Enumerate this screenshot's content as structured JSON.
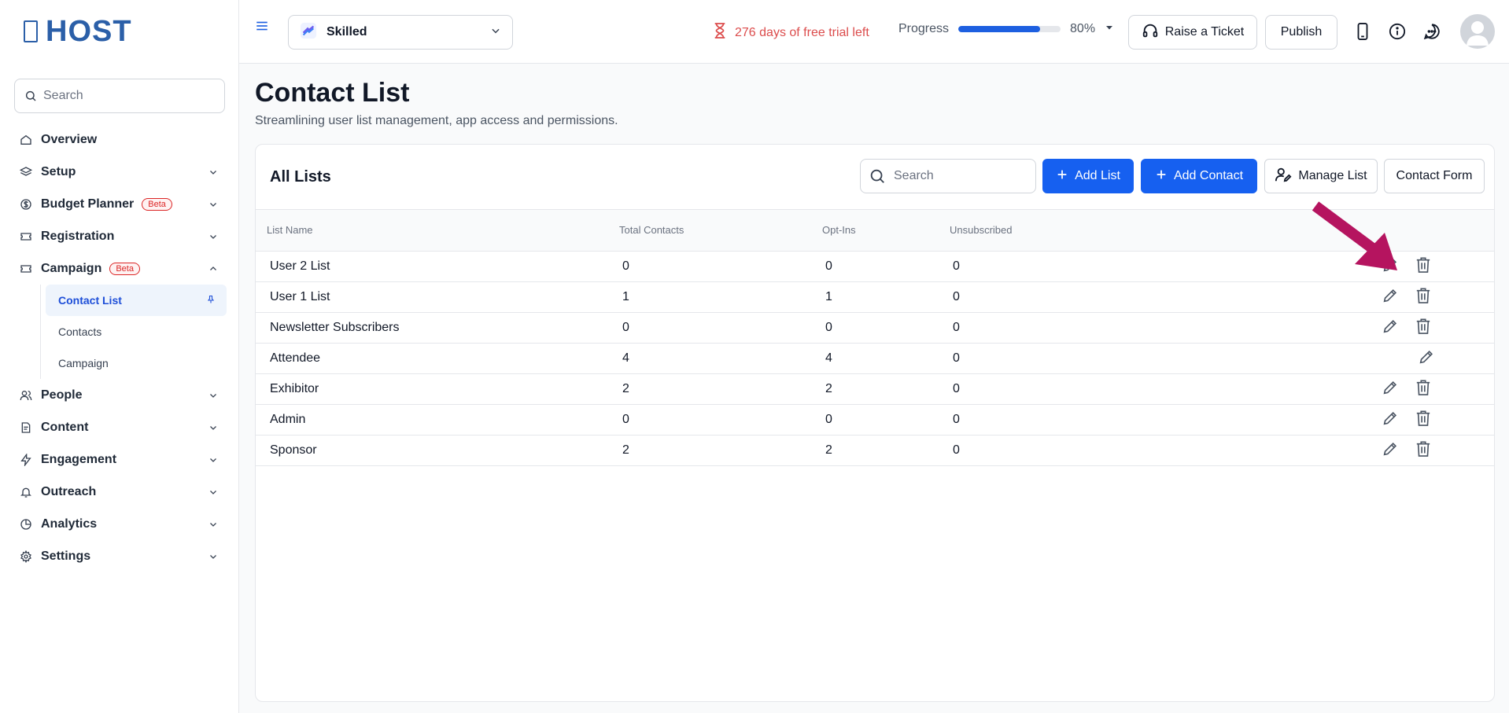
{
  "brand": {
    "name": "HOST"
  },
  "sidebar": {
    "search_placeholder": "Search",
    "items": [
      {
        "label": "Overview",
        "icon": "home-icon",
        "expandable": false
      },
      {
        "label": "Setup",
        "icon": "layers-icon",
        "expandable": true
      },
      {
        "label": "Budget Planner",
        "icon": "dollar-circle-icon",
        "expandable": true,
        "badge": "Beta"
      },
      {
        "label": "Registration",
        "icon": "ticket-icon",
        "expandable": true
      },
      {
        "label": "Campaign",
        "icon": "ticket-icon",
        "expandable": true,
        "expanded": true,
        "badge": "Beta",
        "children": [
          {
            "label": "Contact List",
            "active": true,
            "pinned": true
          },
          {
            "label": "Contacts"
          },
          {
            "label": "Campaign"
          }
        ]
      },
      {
        "label": "People",
        "icon": "users-icon",
        "expandable": true
      },
      {
        "label": "Content",
        "icon": "document-icon",
        "expandable": true
      },
      {
        "label": "Engagement",
        "icon": "bolt-icon",
        "expandable": true
      },
      {
        "label": "Outreach",
        "icon": "bell-icon",
        "expandable": true
      },
      {
        "label": "Analytics",
        "icon": "pie-chart-icon",
        "expandable": true
      },
      {
        "label": "Settings",
        "icon": "gear-icon",
        "expandable": true
      }
    ]
  },
  "topbar": {
    "event_name": "Skilled",
    "trial_text": "276 days of free trial left",
    "progress_label": "Progress",
    "progress_value": 80,
    "progress_text": "80%",
    "raise_ticket": "Raise a Ticket",
    "publish": "Publish"
  },
  "page": {
    "title": "Contact List",
    "subtitle": "Streamlining user list management, app access and permissions."
  },
  "card": {
    "title": "All Lists",
    "search_placeholder": "Search",
    "add_list": "Add List",
    "add_contact": "Add Contact",
    "manage_list": "Manage List",
    "contact_form": "Contact Form"
  },
  "table": {
    "headers": [
      "List Name",
      "Total Contacts",
      "Opt-Ins",
      "Unsubscribed"
    ],
    "rows": [
      {
        "name": "User 2 List",
        "total": "0",
        "optins": "0",
        "unsub": "0",
        "deletable": true
      },
      {
        "name": "User 1 List",
        "total": "1",
        "optins": "1",
        "unsub": "0",
        "deletable": true
      },
      {
        "name": "Newsletter Subscribers",
        "total": "0",
        "optins": "0",
        "unsub": "0",
        "deletable": true
      },
      {
        "name": "Attendee",
        "total": "4",
        "optins": "4",
        "unsub": "0",
        "deletable": false
      },
      {
        "name": "Exhibitor",
        "total": "2",
        "optins": "2",
        "unsub": "0",
        "deletable": true
      },
      {
        "name": "Admin",
        "total": "0",
        "optins": "0",
        "unsub": "0",
        "deletable": true
      },
      {
        "name": "Sponsor",
        "total": "2",
        "optins": "2",
        "unsub": "0",
        "deletable": true
      }
    ]
  },
  "colors": {
    "primary": "#1660f0",
    "brand": "#2b5fa8",
    "trial": "#dc4c4c",
    "beta": "#dc2626",
    "arrow": "#b5145f"
  }
}
